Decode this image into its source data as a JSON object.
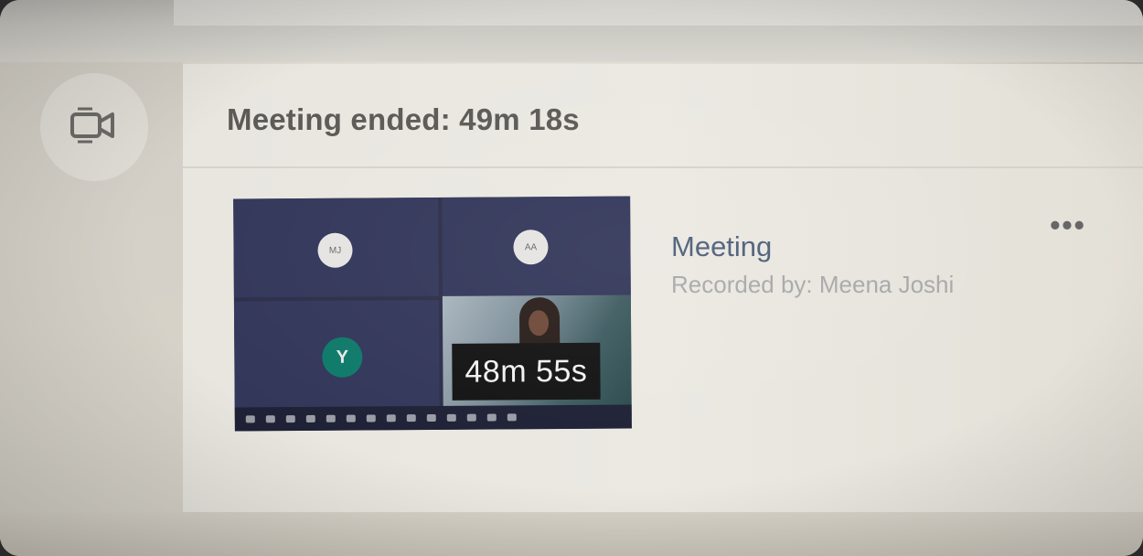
{
  "header": {
    "title": "Meeting ended: 49m 18s",
    "icon": "video-camera-icon"
  },
  "recording": {
    "name": "Meeting",
    "recorded_by": "Recorded by: Meena Joshi",
    "duration": "48m 55s",
    "more_label": "•••",
    "thumbnail": {
      "participant_initials": [
        "MJ",
        "AA",
        "Y"
      ]
    }
  },
  "colors": {
    "title_text": "#5b5a57",
    "meeting_name": "#4f5f7a",
    "recorded_by": "#a8a9aa",
    "thumbnail_bg": "#2c2f48",
    "participant_teal": "#0f7a6a"
  }
}
